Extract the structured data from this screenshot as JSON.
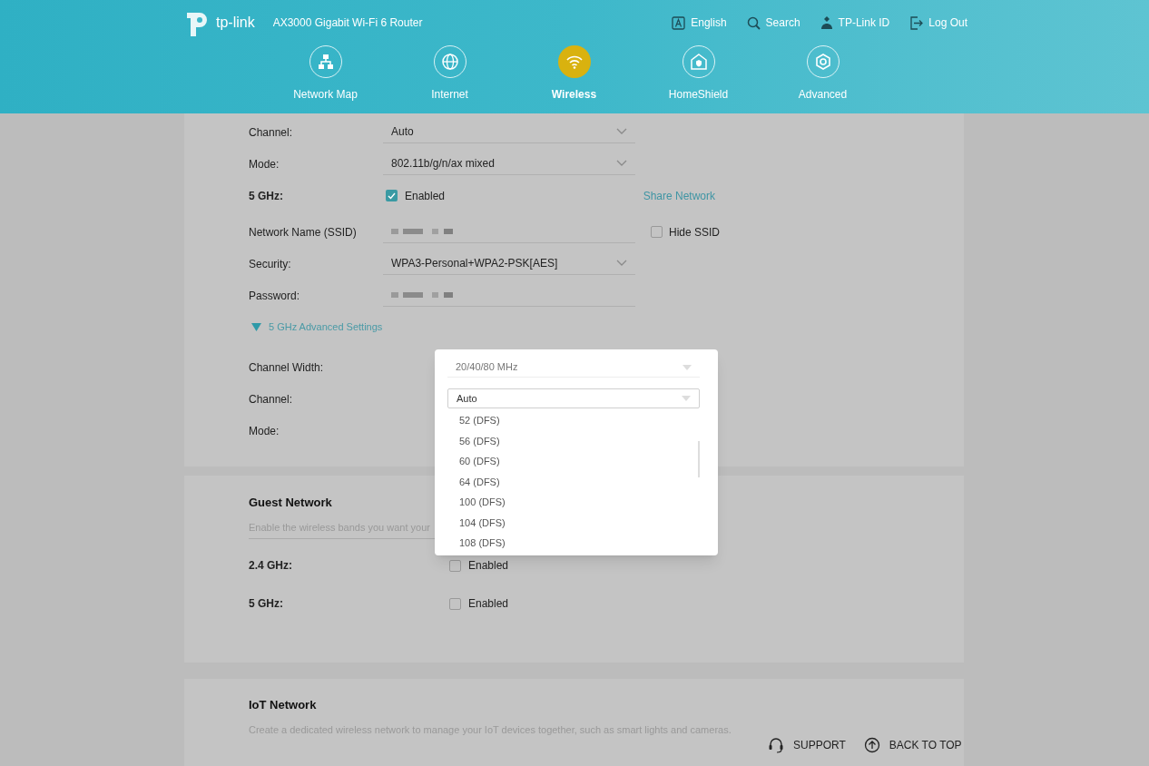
{
  "header": {
    "logo": "tp-link",
    "model": "AX3000 Gigabit Wi-Fi 6 Router",
    "links": [
      {
        "label": "English"
      },
      {
        "label": "Search"
      },
      {
        "label": "TP-Link ID"
      },
      {
        "label": "Log Out"
      }
    ],
    "nav": [
      {
        "label": "Network Map",
        "selected": false
      },
      {
        "label": "Internet",
        "selected": false
      },
      {
        "label": "Wireless",
        "selected": true
      },
      {
        "label": "HomeShield",
        "selected": false
      },
      {
        "label": "Advanced",
        "selected": false
      }
    ]
  },
  "wireless": {
    "rows": [
      {
        "kind": "select",
        "label": "Channel:",
        "value": "Auto"
      },
      {
        "kind": "select",
        "label": "Mode:",
        "value": "802.11b/g/n/ax mixed"
      },
      {
        "kind": "checkbox",
        "label": "5 GHz:",
        "option": "Enabled",
        "checked": true,
        "link": "Share Network"
      },
      {
        "kind": "input",
        "label": "Network Name (SSID)",
        "side_option": "Hide SSID",
        "side_checked": false
      },
      {
        "kind": "select",
        "label": "Security:",
        "value": "WPA3-Personal+WPA2-PSK[AES]"
      },
      {
        "kind": "input",
        "label": "Password:"
      },
      {
        "kind": "expander",
        "label": "5 GHz Advanced Settings",
        "expanded": true
      }
    ],
    "advanced": [
      {
        "label": "Channel Width:",
        "value": "20/40/80 MHz"
      },
      {
        "label": "Channel:",
        "value": "Auto",
        "open": true,
        "options": [
          "52 (DFS)",
          "56 (DFS)",
          "60 (DFS)",
          "64 (DFS)",
          "100 (DFS)",
          "104 (DFS)",
          "108 (DFS)"
        ]
      },
      {
        "label": "Mode:"
      }
    ]
  },
  "guest": {
    "title": "Guest Network",
    "description": "Enable the wireless bands you want your",
    "bands": [
      {
        "label": "2.4 GHz:",
        "option": "Enabled",
        "checked": false
      },
      {
        "label": "5 GHz:",
        "option": "Enabled",
        "checked": false
      }
    ]
  },
  "iot": {
    "title": "IoT Network",
    "description": "Create a dedicated wireless network to manage your IoT devices together, such as smart lights and cameras."
  },
  "footer": [
    {
      "label": "SUPPORT"
    },
    {
      "label": "BACK TO TOP"
    }
  ]
}
